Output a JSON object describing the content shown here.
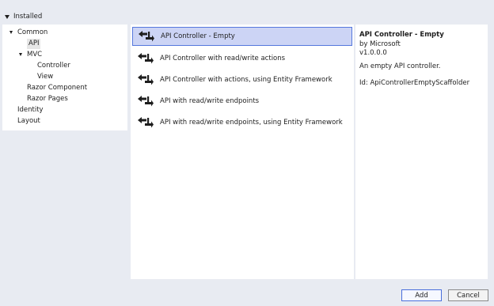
{
  "installed_label": "Installed",
  "tree": {
    "common": "Common",
    "api": "API",
    "mvc": "MVC",
    "controller": "Controller",
    "view": "View",
    "razor_component": "Razor Component",
    "razor_pages": "Razor Pages",
    "identity": "Identity",
    "layout": "Layout"
  },
  "templates": [
    {
      "label": "API Controller - Empty",
      "selected": true,
      "icon": "api-controller-icon"
    },
    {
      "label": "API Controller with read/write actions",
      "selected": false,
      "icon": "api-controller-icon"
    },
    {
      "label": "API Controller with actions, using Entity Framework",
      "selected": false,
      "icon": "api-controller-icon"
    },
    {
      "label": "API with read/write endpoints",
      "selected": false,
      "icon": "api-controller-icon"
    },
    {
      "label": "API with read/write endpoints, using Entity Framework",
      "selected": false,
      "icon": "api-controller-icon"
    }
  ],
  "details": {
    "title": "API Controller - Empty",
    "author": "by Microsoft",
    "version": "v1.0.0.0",
    "description": "An empty API controller.",
    "id": "Id: ApiControllerEmptyScaffolder"
  },
  "buttons": {
    "add": "Add",
    "cancel": "Cancel"
  },
  "colors": {
    "selection_fill": "#ccd4f5",
    "selection_border": "#5577dd",
    "panel_background": "#e8ebf2"
  }
}
